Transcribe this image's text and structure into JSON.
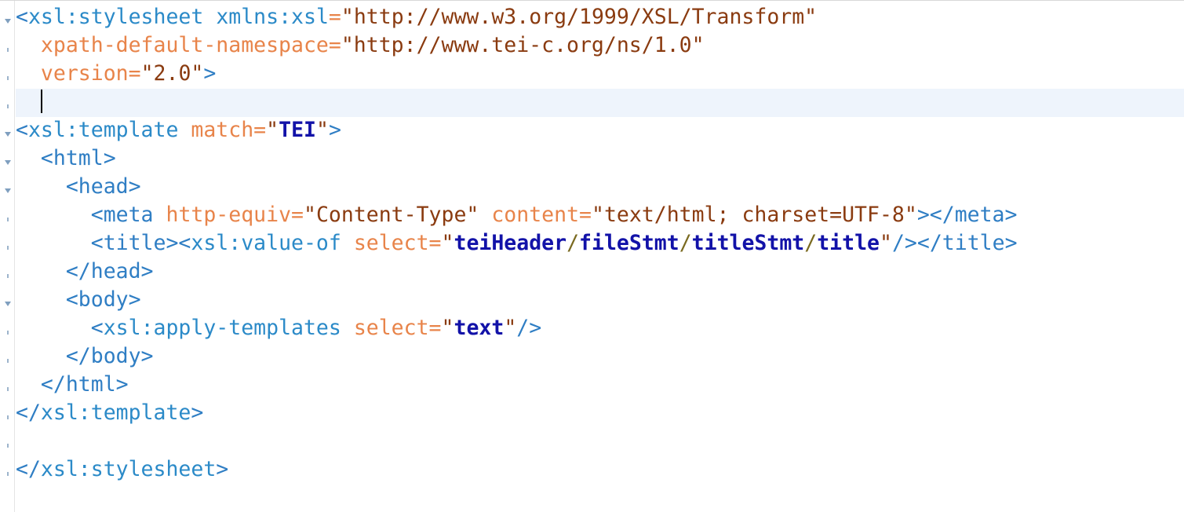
{
  "editor": {
    "caret_line": 4,
    "lines": [
      {
        "fold": true,
        "tokens": [
          {
            "t": "<",
            "c": "t-punct"
          },
          {
            "t": "xsl:stylesheet",
            "c": "t-xsl"
          },
          {
            "t": " ",
            "c": "t-text"
          },
          {
            "t": "xmlns:xsl",
            "c": "t-xsl"
          },
          {
            "t": "=",
            "c": "t-attr"
          },
          {
            "t": "\"http://www.w3.org/1999/XSL/Transform\"",
            "c": "t-str"
          }
        ]
      },
      {
        "fold": false,
        "tokens": [
          {
            "t": "  ",
            "c": "t-text"
          },
          {
            "t": "xpath-default-namespace",
            "c": "t-attr"
          },
          {
            "t": "=",
            "c": "t-attr"
          },
          {
            "t": "\"http://www.tei-c.org/ns/1.0\"",
            "c": "t-str"
          }
        ]
      },
      {
        "fold": false,
        "tokens": [
          {
            "t": "  ",
            "c": "t-text"
          },
          {
            "t": "version",
            "c": "t-attr"
          },
          {
            "t": "=",
            "c": "t-attr"
          },
          {
            "t": "\"2.0\"",
            "c": "t-str"
          },
          {
            "t": ">",
            "c": "t-punct"
          }
        ]
      },
      {
        "fold": false,
        "caret": true,
        "tokens": [
          {
            "t": "  ",
            "c": "t-text"
          }
        ]
      },
      {
        "fold": true,
        "tokens": [
          {
            "t": "<",
            "c": "t-punct"
          },
          {
            "t": "xsl:template",
            "c": "t-xsl"
          },
          {
            "t": " ",
            "c": "t-text"
          },
          {
            "t": "match",
            "c": "t-attr"
          },
          {
            "t": "=",
            "c": "t-attr"
          },
          {
            "t": "\"",
            "c": "t-q"
          },
          {
            "t": "TEI",
            "c": "t-xpath"
          },
          {
            "t": "\"",
            "c": "t-q"
          },
          {
            "t": ">",
            "c": "t-punct"
          }
        ]
      },
      {
        "fold": true,
        "tokens": [
          {
            "t": "  ",
            "c": "t-text"
          },
          {
            "t": "<html>",
            "c": "t-tag"
          }
        ]
      },
      {
        "fold": true,
        "tokens": [
          {
            "t": "    ",
            "c": "t-text"
          },
          {
            "t": "<head>",
            "c": "t-tag"
          }
        ]
      },
      {
        "fold": false,
        "tokens": [
          {
            "t": "      ",
            "c": "t-text"
          },
          {
            "t": "<meta",
            "c": "t-tag"
          },
          {
            "t": " ",
            "c": "t-text"
          },
          {
            "t": "http-equiv",
            "c": "t-attr"
          },
          {
            "t": "=",
            "c": "t-attr"
          },
          {
            "t": "\"Content-Type\"",
            "c": "t-str"
          },
          {
            "t": " ",
            "c": "t-text"
          },
          {
            "t": "content",
            "c": "t-attr"
          },
          {
            "t": "=",
            "c": "t-attr"
          },
          {
            "t": "\"text/html; charset=UTF-8\"",
            "c": "t-str"
          },
          {
            "t": "></meta>",
            "c": "t-tag"
          }
        ]
      },
      {
        "fold": false,
        "tokens": [
          {
            "t": "      ",
            "c": "t-text"
          },
          {
            "t": "<title>",
            "c": "t-tag"
          },
          {
            "t": "<",
            "c": "t-punct"
          },
          {
            "t": "xsl:value-of",
            "c": "t-xsl"
          },
          {
            "t": " ",
            "c": "t-text"
          },
          {
            "t": "select",
            "c": "t-attr"
          },
          {
            "t": "=",
            "c": "t-attr"
          },
          {
            "t": "\"",
            "c": "t-q"
          },
          {
            "t": "teiHeader",
            "c": "t-xpath"
          },
          {
            "t": "/",
            "c": "t-slash"
          },
          {
            "t": "fileStmt",
            "c": "t-xpath"
          },
          {
            "t": "/",
            "c": "t-slash"
          },
          {
            "t": "titleStmt",
            "c": "t-xpath"
          },
          {
            "t": "/",
            "c": "t-slash"
          },
          {
            "t": "title",
            "c": "t-xpath"
          },
          {
            "t": "\"",
            "c": "t-q"
          },
          {
            "t": "/>",
            "c": "t-punct"
          },
          {
            "t": "</title>",
            "c": "t-tag"
          }
        ]
      },
      {
        "fold": false,
        "tokens": [
          {
            "t": "    ",
            "c": "t-text"
          },
          {
            "t": "</head>",
            "c": "t-tag"
          }
        ]
      },
      {
        "fold": true,
        "tokens": [
          {
            "t": "    ",
            "c": "t-text"
          },
          {
            "t": "<body>",
            "c": "t-tag"
          }
        ]
      },
      {
        "fold": false,
        "tokens": [
          {
            "t": "      ",
            "c": "t-text"
          },
          {
            "t": "<",
            "c": "t-punct"
          },
          {
            "t": "xsl:apply-templates",
            "c": "t-xsl"
          },
          {
            "t": " ",
            "c": "t-text"
          },
          {
            "t": "select",
            "c": "t-attr"
          },
          {
            "t": "=",
            "c": "t-attr"
          },
          {
            "t": "\"",
            "c": "t-q"
          },
          {
            "t": "text",
            "c": "t-xpath"
          },
          {
            "t": "\"",
            "c": "t-q"
          },
          {
            "t": "/>",
            "c": "t-punct"
          }
        ]
      },
      {
        "fold": false,
        "tokens": [
          {
            "t": "    ",
            "c": "t-text"
          },
          {
            "t": "</body>",
            "c": "t-tag"
          }
        ]
      },
      {
        "fold": false,
        "tokens": [
          {
            "t": "  ",
            "c": "t-text"
          },
          {
            "t": "</html>",
            "c": "t-tag"
          }
        ]
      },
      {
        "fold": false,
        "tokens": [
          {
            "t": "</",
            "c": "t-punct"
          },
          {
            "t": "xsl:template",
            "c": "t-xsl"
          },
          {
            "t": ">",
            "c": "t-punct"
          }
        ]
      },
      {
        "fold": false,
        "tokens": []
      },
      {
        "fold": false,
        "tokens": [
          {
            "t": "</",
            "c": "t-punct"
          },
          {
            "t": "xsl:stylesheet",
            "c": "t-xsl"
          },
          {
            "t": ">",
            "c": "t-punct"
          }
        ]
      }
    ]
  },
  "colors": {
    "element": "#2f7ec4",
    "attribute": "#e8844a",
    "string": "#8a3b10",
    "xpath": "#1212a8",
    "current_line": "#eef4fc"
  },
  "icons": {
    "fold": "fold-toggle-icon",
    "marker": "line-marker-icon"
  }
}
